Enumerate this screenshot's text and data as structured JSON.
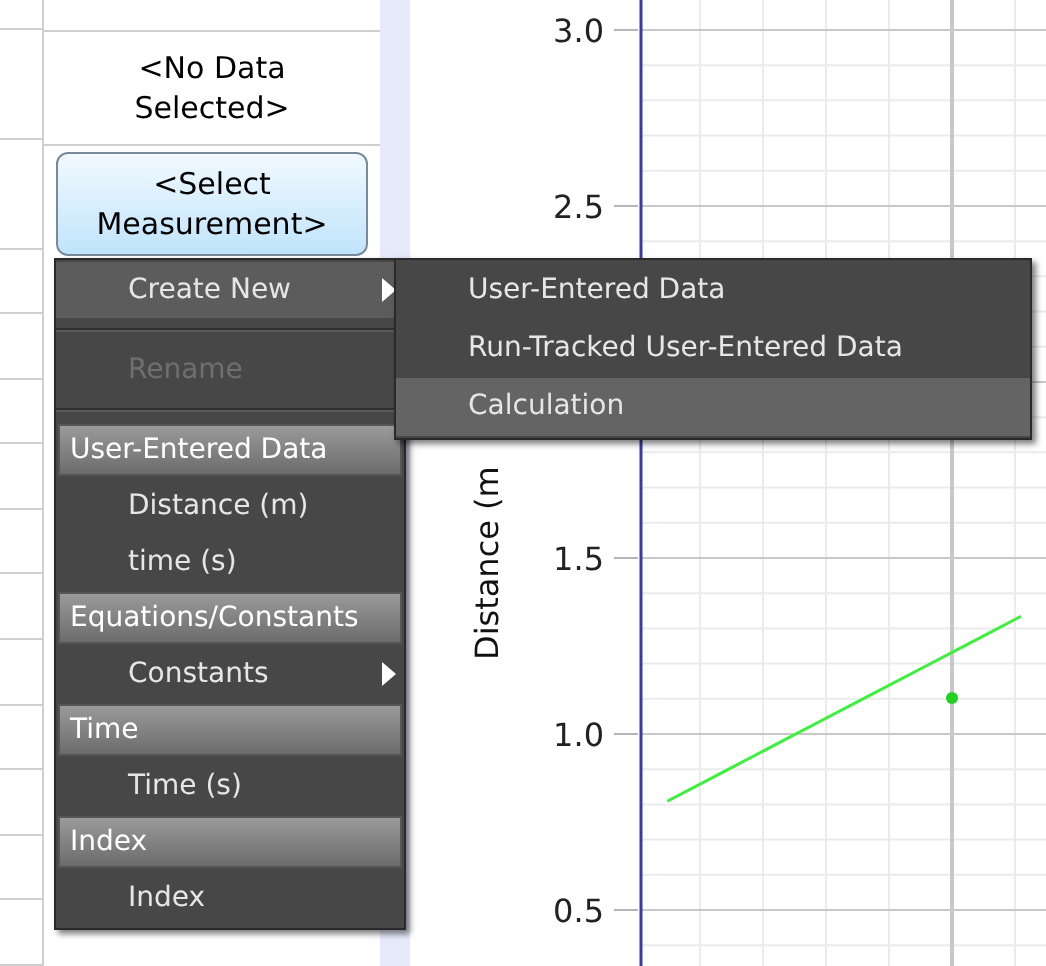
{
  "table": {
    "header_cell": "<No Data Selected>",
    "select_button": "<Select Measurement>"
  },
  "context_menu": {
    "items": [
      {
        "kind": "item",
        "label": "Create New",
        "has_submenu": true,
        "selected": true,
        "disabled": false
      },
      {
        "kind": "separator"
      },
      {
        "kind": "item",
        "label": "Rename",
        "has_submenu": false,
        "selected": false,
        "disabled": true
      },
      {
        "kind": "separator"
      },
      {
        "kind": "header",
        "label": "User-Entered Data"
      },
      {
        "kind": "item",
        "label": "Distance (m)",
        "has_submenu": false,
        "selected": false,
        "disabled": false
      },
      {
        "kind": "item",
        "label": "time (s)",
        "has_submenu": false,
        "selected": false,
        "disabled": false
      },
      {
        "kind": "header",
        "label": "Equations/Constants"
      },
      {
        "kind": "item",
        "label": "Constants",
        "has_submenu": true,
        "selected": false,
        "disabled": false
      },
      {
        "kind": "header",
        "label": "Time"
      },
      {
        "kind": "item",
        "label": "Time (s)",
        "has_submenu": false,
        "selected": false,
        "disabled": false
      },
      {
        "kind": "header",
        "label": "Index"
      },
      {
        "kind": "item",
        "label": "Index",
        "has_submenu": false,
        "selected": false,
        "disabled": false
      }
    ]
  },
  "submenu": {
    "items": [
      {
        "label": "User-Entered Data",
        "selected": false
      },
      {
        "label": "Run-Tracked User-Entered Data",
        "selected": false
      },
      {
        "label": "Calculation",
        "selected": true
      }
    ]
  },
  "graph": {
    "chart_data": {
      "type": "line",
      "ylabel": "Distance (m",
      "ylim": [
        0.341,
        3.085
      ],
      "categories": [
        null,
        null,
        null,
        null,
        null,
        null,
        null,
        null
      ],
      "grid": true,
      "series": [
        {
          "color": "#3cf03c",
          "values": [
            0.809,
            0.884,
            0.959,
            1.034,
            1.109,
            1.184,
            1.259,
            1.334
          ]
        }
      ],
      "yticks": [
        {
          "value": 3,
          "label": "3.0"
        },
        {
          "value": 2.5,
          "label": "2.5"
        },
        {
          "value": 1.5,
          "label": "1.5"
        },
        {
          "value": 1,
          "label": "1.0"
        },
        {
          "value": 0.5,
          "label": "0.5"
        }
      ]
    }
  }
}
